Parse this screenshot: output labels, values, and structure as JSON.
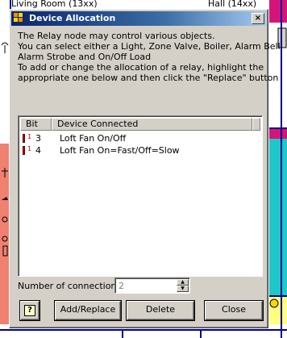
{
  "background": {
    "room_left_title": "Living Room (13xx)",
    "room_right_title": "Hall (14xx)"
  },
  "dialog": {
    "title": "Device Allocation",
    "close_glyph": "×",
    "description_lines": [
      "The Relay node may control various objects.",
      "You can select either a Light, Zone Valve, Boiler, Alarm Bell,",
      "Alarm Strobe and On/Off Load",
      "To add or change the allocation of a relay, highlight the",
      "appropriate one below and then click the \"Replace\" button"
    ],
    "list": {
      "columns": [
        "Bit",
        "Device Connected"
      ],
      "rows": [
        {
          "bit": "3",
          "device": "Loft Fan On/Off",
          "icon": "relay-icon",
          "icon_text": "1"
        },
        {
          "bit": "4",
          "device": "Loft Fan On=Fast/Off=Slow",
          "icon": "relay-icon",
          "icon_text": "1"
        }
      ]
    },
    "connections": {
      "label": "Number of connections",
      "value": "2"
    },
    "buttons": {
      "help": "?",
      "add_replace": "Add/Replace",
      "delete": "Delete",
      "close": "Close"
    }
  },
  "colors": {
    "dialog_face": "#d4d0c8",
    "title_start": "#0a246a",
    "title_end": "#a6caf0",
    "bg_magenta": "#d4147a",
    "bg_teal": "#1ec8c8",
    "bg_yellow": "#ffff80",
    "bg_salmon": "#f08070",
    "relay_red": "#c00000"
  }
}
